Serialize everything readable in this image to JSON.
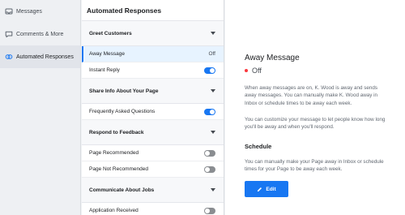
{
  "nav": {
    "items": [
      {
        "label": "Messages",
        "icon": "inbox-icon",
        "active": false
      },
      {
        "label": "Comments & More",
        "icon": "comment-icon",
        "active": false
      },
      {
        "label": "Automated Responses",
        "icon": "automation-icon",
        "active": true
      }
    ]
  },
  "list": {
    "title": "Automated Responses",
    "sections": [
      {
        "label": "Greet Customers"
      },
      {
        "label": "Share Info About Your Page"
      },
      {
        "label": "Respond to Feedback"
      },
      {
        "label": "Communicate About Jobs"
      }
    ],
    "rows": {
      "away_message": {
        "label": "Away Message",
        "status": "Off"
      },
      "instant_reply": {
        "label": "Instant Reply",
        "on": true
      },
      "faq": {
        "label": "Frequently Asked Questions",
        "on": true
      },
      "page_recommended": {
        "label": "Page Recommended",
        "on": false
      },
      "page_not_recommended": {
        "label": "Page Not Recommended",
        "on": false
      },
      "application_received": {
        "label": "Application Received",
        "on": false
      }
    }
  },
  "detail": {
    "title": "Away Message",
    "state": "Off",
    "state_color": "#fa383e",
    "paragraph1": "When away messages are on, K. Wood is away and sends away messages. You can manually make K. Wood away in Inbox or schedule times to be away each week.",
    "paragraph2": "You can customize your message to let people know how long you'll be away and when you'll respond.",
    "schedule_heading": "Schedule",
    "paragraph3": "You can manually make your Page away in Inbox or schedule times for your Page to be away each week.",
    "edit_label": "Edit"
  },
  "colors": {
    "accent": "#1877f2",
    "selected_bg": "#e7f3ff"
  }
}
